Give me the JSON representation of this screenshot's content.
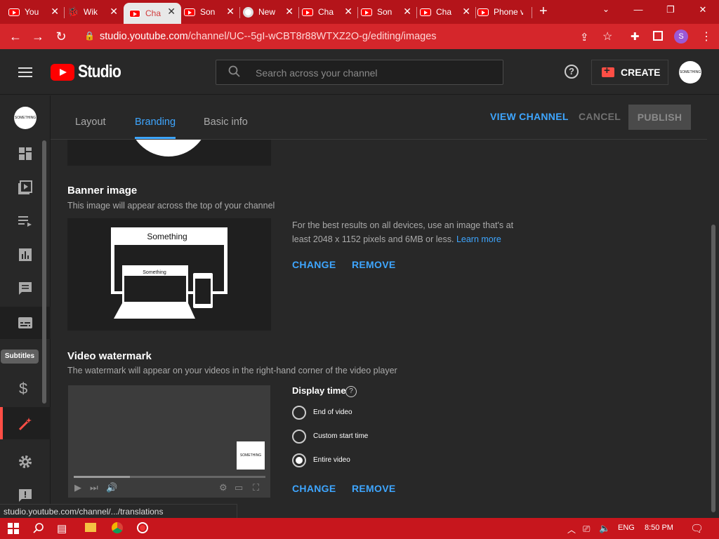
{
  "browser": {
    "tabs": [
      {
        "label": "You",
        "icon": "youtube-icon"
      },
      {
        "label": "Wik",
        "icon": "wiki-icon"
      },
      {
        "label": "Cha",
        "icon": "youtube-icon"
      },
      {
        "label": "Son",
        "icon": "youtube-icon"
      },
      {
        "label": "New",
        "icon": "chrome-icon"
      },
      {
        "label": "Cha",
        "icon": "youtube-icon"
      },
      {
        "label": "Son",
        "icon": "youtube-icon"
      },
      {
        "label": "Cha",
        "icon": "youtube-icon"
      },
      {
        "label": "Phone v",
        "icon": "youtube-icon"
      }
    ],
    "active_tab": 2,
    "url_host": "studio.youtube.com",
    "url_path": "/channel/UC--5gI-wCBT8r88WTXZ2O-g/editing/images",
    "profile_initial": "S",
    "status_url": "studio.youtube.com/channel/.../translations"
  },
  "header": {
    "logo_text": "Studio",
    "search_placeholder": "Search across your channel",
    "create_label": "CREATE",
    "avatar_text": "SOMETHING"
  },
  "rail": {
    "avatar_text": "SOMETHING",
    "tooltip": "Subtitles"
  },
  "tabs": [
    {
      "label": "Layout"
    },
    {
      "label": "Branding"
    },
    {
      "label": "Basic info"
    }
  ],
  "actions": {
    "view_channel": "VIEW CHANNEL",
    "cancel": "CANCEL",
    "publish": "PUBLISH"
  },
  "banner": {
    "title": "Banner image",
    "subtitle": "This image will appear across the top of your channel",
    "desc": "For the best results on all devices, use an image that's at least 2048 x 1152 pixels and 6MB or less.",
    "learn_more": "Learn more",
    "mock_big_text": "Something",
    "mock_small_text": "Something",
    "change": "CHANGE",
    "remove": "REMOVE"
  },
  "watermark": {
    "title": "Video watermark",
    "subtitle": "The watermark will appear on your videos in the right-hand corner of the video player",
    "thumb_text": "SOMETHING",
    "display_time_label": "Display time",
    "options": [
      "End of video",
      "Custom start time",
      "Entire video"
    ],
    "selected_option": "Entire video",
    "change": "CHANGE",
    "remove": "REMOVE"
  },
  "taskbar": {
    "lang": "ENG",
    "time": "8:50 PM"
  },
  "colors": {
    "accent_blue": "#3ea6ff",
    "brand_red": "#ff0000",
    "browser_red": "#d5262b"
  }
}
